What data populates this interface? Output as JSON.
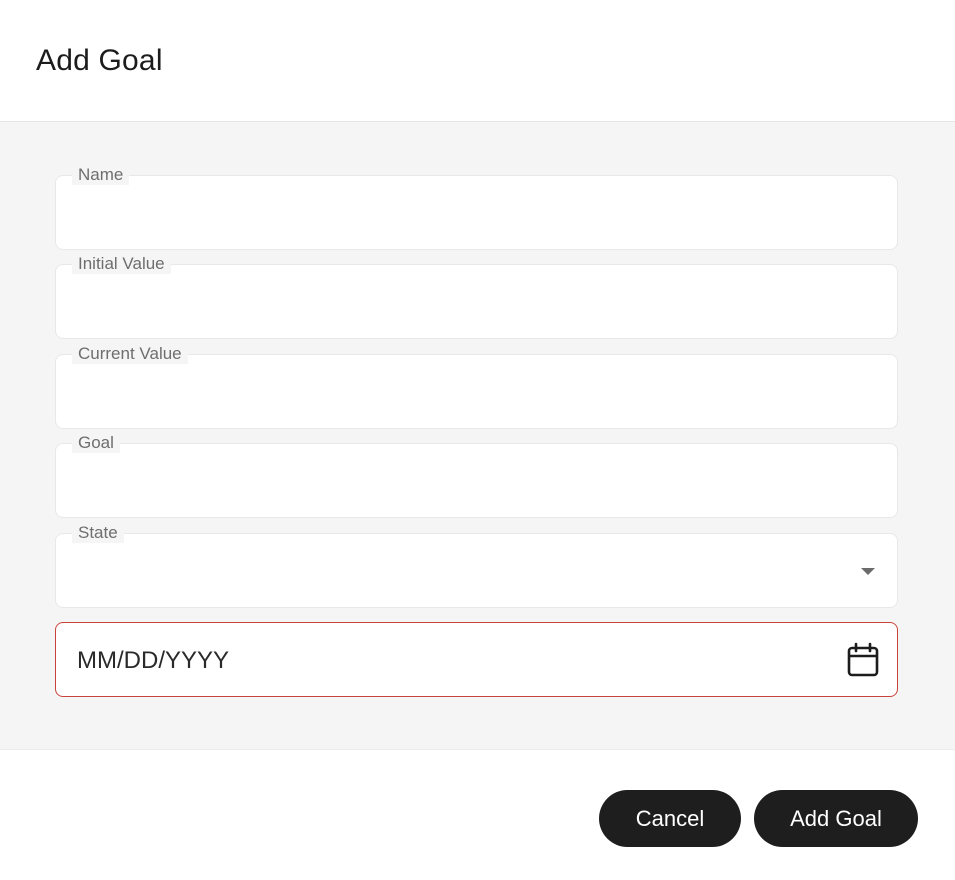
{
  "dialog": {
    "title": "Add Goal"
  },
  "form": {
    "name": {
      "label": "Name",
      "value": ""
    },
    "initial_value": {
      "label": "Initial Value",
      "value": ""
    },
    "current_value": {
      "label": "Current Value",
      "value": ""
    },
    "goal": {
      "label": "Goal",
      "value": ""
    },
    "state": {
      "label": "State",
      "value": ""
    },
    "date": {
      "placeholder": "MM/DD/YYYY",
      "value": ""
    }
  },
  "footer": {
    "cancel_label": "Cancel",
    "add_label": "Add Goal"
  },
  "colors": {
    "button_bg": "#1e1e1e",
    "error_border": "#c8443a",
    "body_bg": "#f5f5f5"
  },
  "icons": {
    "state_dropdown": "caret-down-icon",
    "date_picker": "calendar-icon"
  }
}
